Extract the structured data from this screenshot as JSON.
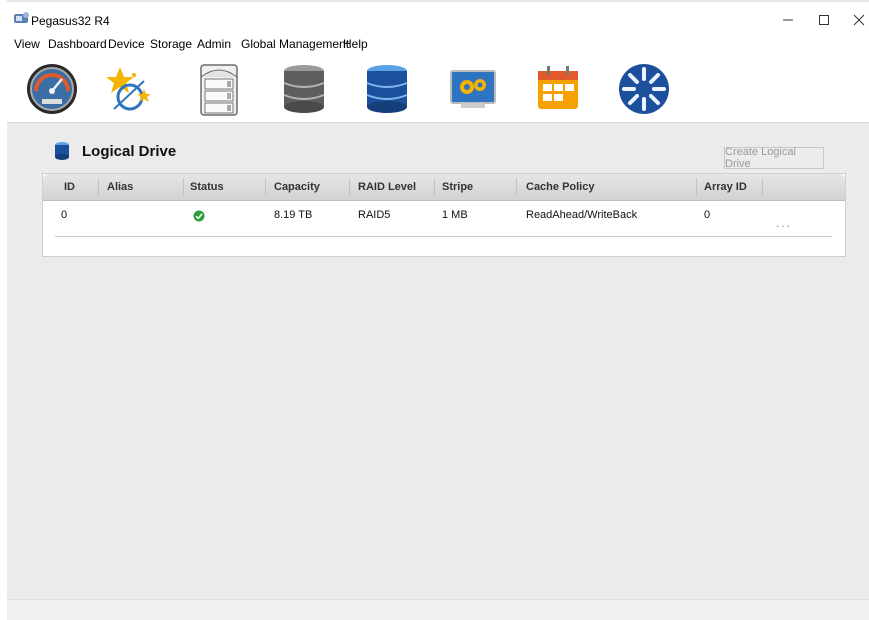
{
  "window": {
    "title": "Pegasus32 R4"
  },
  "menu": [
    "View",
    "Dashboard",
    "Device",
    "Storage",
    "Admin",
    "Global Management",
    "Help"
  ],
  "toolbar": {
    "icons": [
      "dashboard-gauge-icon",
      "wizard-icon",
      "enclosure-icon",
      "physical-drive-icon",
      "logical-drive-icon",
      "background-activity-icon",
      "scheduler-icon",
      "spare-drive-icon"
    ]
  },
  "panel": {
    "title": "Logical Drive",
    "create_button": "Create Logical Drive"
  },
  "grid": {
    "columns": [
      "ID",
      "Alias",
      "Status",
      "Capacity",
      "RAID Level",
      "Stripe",
      "Cache Policy",
      "Array ID"
    ],
    "rows": [
      {
        "id": "0",
        "alias": "",
        "status": "ok",
        "capacity": "8.19 TB",
        "raid_level": "RAID5",
        "stripe": "1 MB",
        "cache_policy": "ReadAhead/WriteBack",
        "array_id": "0",
        "more": "..."
      }
    ]
  },
  "colors": {
    "accent": "#4a90d9",
    "status_ok": "#2e9e3a",
    "content_bg": "#ebebeb"
  }
}
